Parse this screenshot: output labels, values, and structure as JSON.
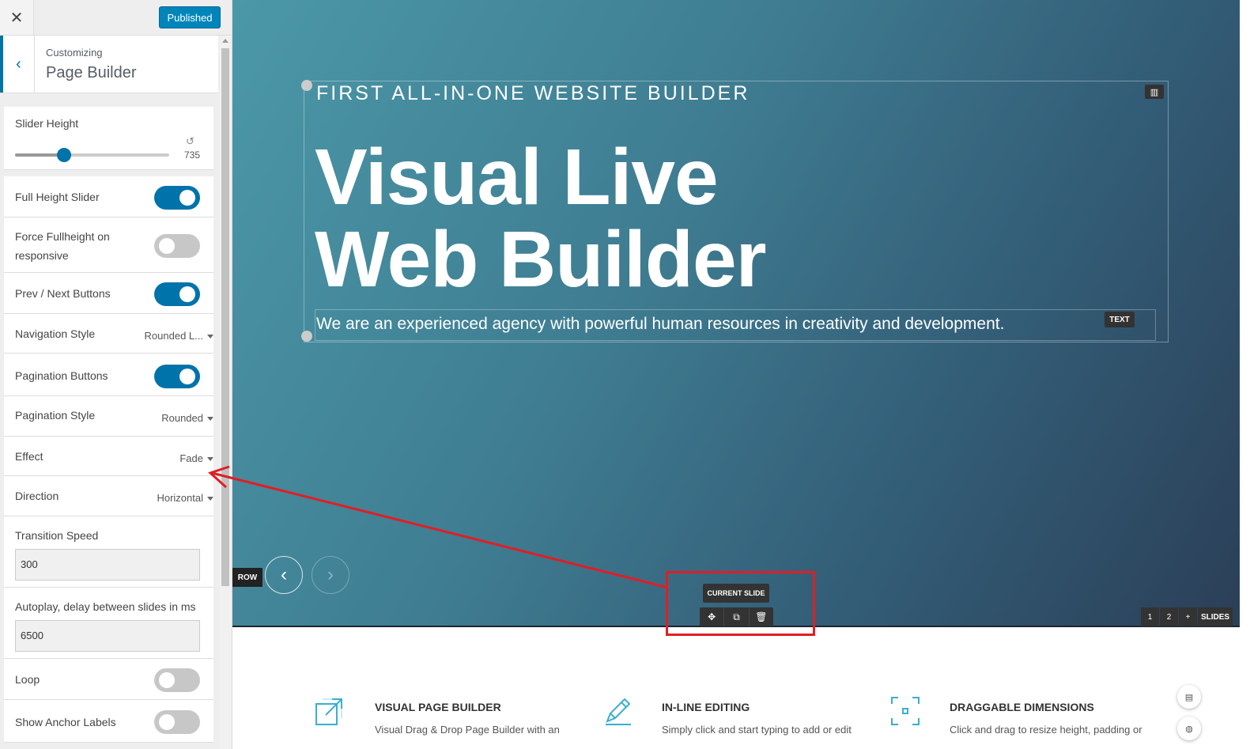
{
  "topbar": {
    "close_icon": "close-icon",
    "publish_label": "Published"
  },
  "panel": {
    "customizing_label": "Customizing",
    "title": "Page Builder"
  },
  "controls": {
    "slider_height": {
      "label": "Slider Height",
      "value": "735",
      "fraction": 0.32
    },
    "full_height": {
      "label": "Full Height Slider",
      "on": true
    },
    "force_fullheight": {
      "label_line1": "Force Fullheight on",
      "label_line2": "responsive",
      "on": false
    },
    "prev_next": {
      "label": "Prev / Next Buttons",
      "on": true
    },
    "navigation_style": {
      "label": "Navigation Style",
      "value": "Rounded L..."
    },
    "pagination_buttons": {
      "label": "Pagination Buttons",
      "on": true
    },
    "pagination_style": {
      "label": "Pagination Style",
      "value": "Rounded"
    },
    "effect": {
      "label": "Effect",
      "value": "Fade"
    },
    "direction": {
      "label": "Direction",
      "value": "Horizontal"
    },
    "transition_speed": {
      "label": "Transition Speed",
      "value": "300"
    },
    "autoplay": {
      "label": "Autoplay, delay between slides in ms",
      "value": "6500"
    },
    "loop": {
      "label": "Loop",
      "on": false
    },
    "anchor_labels": {
      "label": "Show Anchor Labels",
      "on": false
    }
  },
  "hero": {
    "eyebrow": "FIRST ALL-IN-ONE WEBSITE BUILDER",
    "headline_line1": "Visual Live",
    "headline_line2": "Web Builder",
    "subline": "We are an experienced agency with powerful human resources in creativity and development.",
    "text_badge": "TEXT",
    "row_badge": "ROW",
    "current_slide_label": "CURRENT SLIDE",
    "slides_pages": [
      "1",
      "2"
    ],
    "slides_add": "+",
    "slides_label": "SLIDES"
  },
  "features": [
    {
      "icon": "expand-icon",
      "title": "VISUAL PAGE BUILDER",
      "desc": "Visual Drag & Drop Page Builder with an"
    },
    {
      "icon": "pencil-icon",
      "title": "IN-LINE EDITING",
      "desc": "Simply click  and start typing to add or edit"
    },
    {
      "icon": "resize-frame-icon",
      "title": "DRAGGABLE DIMENSIONS",
      "desc": "Click and drag to resize height, padding or"
    }
  ],
  "colors": {
    "accent": "#0073aa",
    "publish": "#0085ba",
    "annotation_red": "#e01e25",
    "icon_teal": "#3aaed0"
  }
}
